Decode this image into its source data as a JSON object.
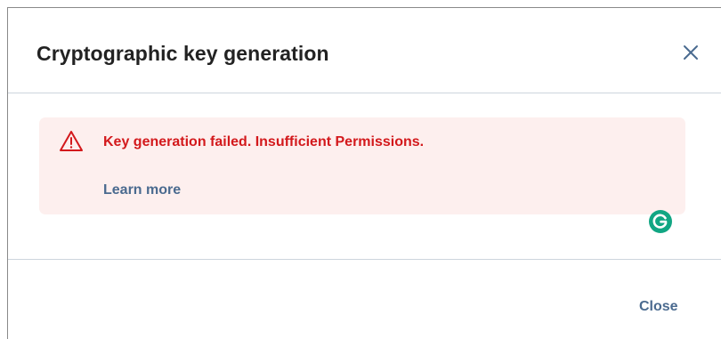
{
  "dialog": {
    "title": "Cryptographic key generation",
    "close_icon": "close-icon",
    "close_label": "Close"
  },
  "alert": {
    "icon": "warning-triangle-icon",
    "message": "Key generation failed. Insufficient Permissions.",
    "link_label": "Learn more",
    "message_color": "#d3191c",
    "background_color": "#fdefee"
  },
  "overlay": {
    "grammarly_icon": "grammarly-icon",
    "grammarly_color": "#11a683"
  },
  "colors": {
    "link": "#4a6a8f",
    "title": "#222222",
    "divider": "#cdd5dd"
  }
}
